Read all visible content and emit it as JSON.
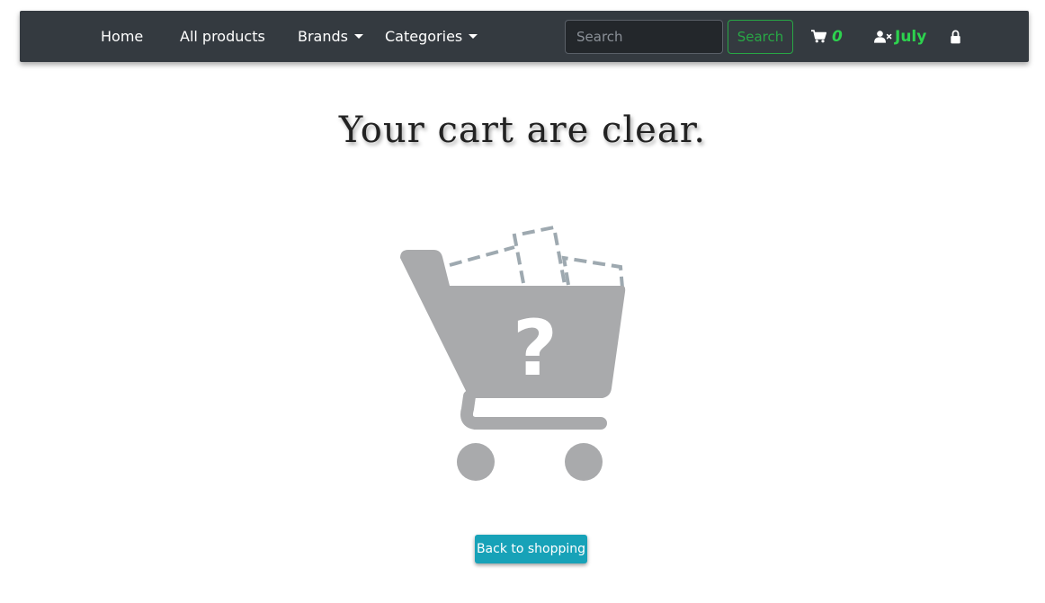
{
  "nav": {
    "home": "Home",
    "all_products": "All products",
    "brands": "Brands",
    "categories": "Categories",
    "search_placeholder": "Search",
    "search_button": "Search",
    "cart_count": "0",
    "username": "July"
  },
  "main": {
    "heading": "Your cart are clear.",
    "back_button": "Back to shopping",
    "empty_cart_question_mark": "?"
  },
  "icons": {
    "cart": "shopping-cart-icon",
    "user": "user-times-icon",
    "lock": "lock-icon"
  },
  "colors": {
    "navbar_bg": "#343a40",
    "accent_green": "#28a745",
    "count_green": "#2dd24e",
    "button_info": "#17a2b8",
    "illustration_gray": "#a9aaac"
  }
}
